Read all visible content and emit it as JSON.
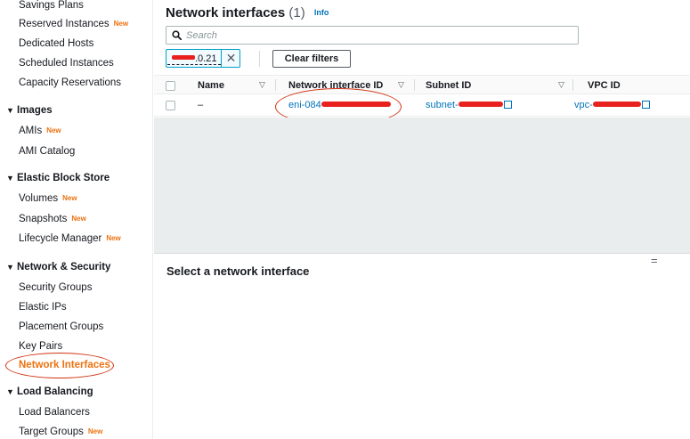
{
  "sidebar": {
    "items": [
      {
        "label": "Savings Plans"
      },
      {
        "label": "Reserved Instances",
        "badge": "New"
      },
      {
        "label": "Dedicated Hosts"
      },
      {
        "label": "Scheduled Instances"
      },
      {
        "label": "Capacity Reservations"
      }
    ],
    "sections": [
      {
        "label": "Images",
        "items": [
          {
            "label": "AMIs",
            "badge": "New"
          },
          {
            "label": "AMI Catalog"
          }
        ]
      },
      {
        "label": "Elastic Block Store",
        "items": [
          {
            "label": "Volumes",
            "badge": "New"
          },
          {
            "label": "Snapshots",
            "badge": "New"
          },
          {
            "label": "Lifecycle Manager",
            "badge": "New"
          }
        ]
      },
      {
        "label": "Network & Security",
        "items": [
          {
            "label": "Security Groups"
          },
          {
            "label": "Elastic IPs"
          },
          {
            "label": "Placement Groups"
          },
          {
            "label": "Key Pairs"
          },
          {
            "label": "Network Interfaces",
            "active": true
          }
        ]
      },
      {
        "label": "Load Balancing",
        "items": [
          {
            "label": "Load Balancers"
          },
          {
            "label": "Target Groups",
            "badge": "New"
          }
        ]
      }
    ]
  },
  "main": {
    "title": "Network interfaces",
    "count": "(1)",
    "info_label": "Info",
    "search": {
      "placeholder": "Search",
      "value": ""
    },
    "filter_token": {
      "visible_suffix": ".0.21"
    },
    "clear_filters_label": "Clear filters",
    "table": {
      "columns": [
        "Name",
        "Network interface ID",
        "Subnet ID",
        "VPC ID"
      ],
      "rows": [
        {
          "name": "–",
          "eni_prefix": "eni-084",
          "subnet_prefix": "subnet-",
          "vpc_prefix": "vpc-"
        }
      ]
    },
    "detail_title": "Select a network interface"
  },
  "colors": {
    "accent": "#ec7211",
    "link": "#0073bb",
    "annotation": "#d13212",
    "redaction": "#e8211f"
  },
  "icons": [
    "search-icon",
    "close-icon",
    "sort-icon",
    "external-link-icon",
    "caret-down-icon",
    "drag-handle-icon"
  ]
}
